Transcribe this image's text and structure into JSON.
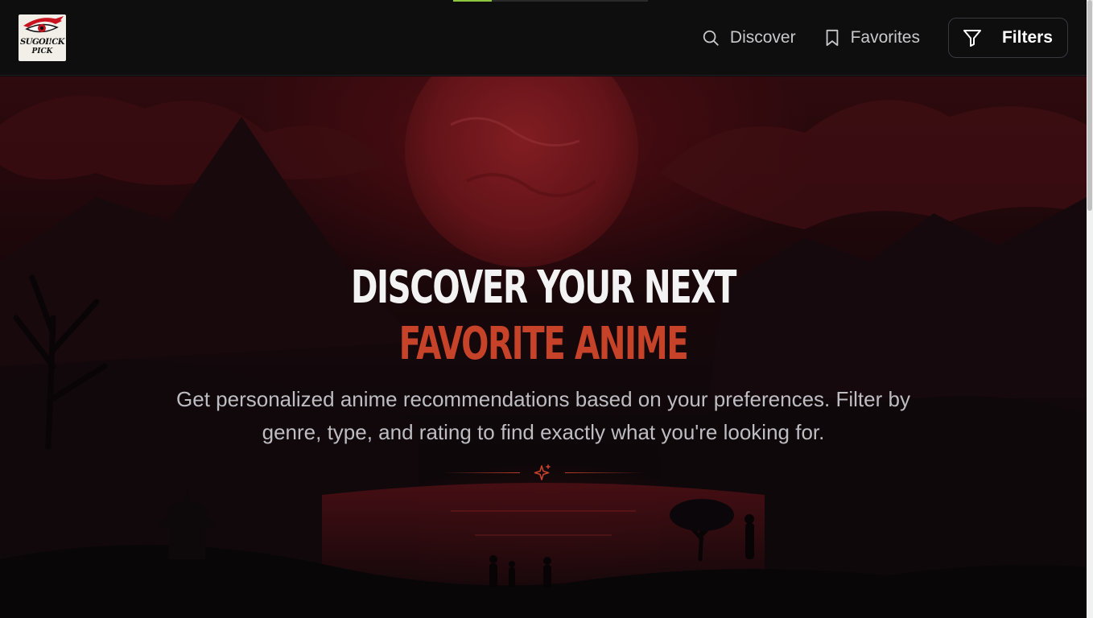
{
  "header": {
    "logo": {
      "line1": "SUGOI!CK",
      "line2": "PICK",
      "icon": "eye-logo-icon"
    },
    "nav": [
      {
        "label": "Discover",
        "icon": "search-icon"
      },
      {
        "label": "Favorites",
        "icon": "bookmark-icon"
      }
    ],
    "filters_label": "Filters",
    "filters_icon": "filter-icon"
  },
  "loading_bar": {
    "progress": 0.2,
    "color": "#8dc63f"
  },
  "hero": {
    "title_line1": "DISCOVER YOUR NEXT",
    "title_line2": "FAVORITE ANIME",
    "subtitle": "Get personalized anime recommendations based on your preferences. Filter by genre, type, and rating to find exactly what you're looking for.",
    "divider_icon": "sparkle-icon"
  },
  "colors": {
    "accent": "#c6432a",
    "header_bg": "#0e0e0f",
    "title_white": "#f3f3f3",
    "subtitle": "#bdbdc2"
  }
}
